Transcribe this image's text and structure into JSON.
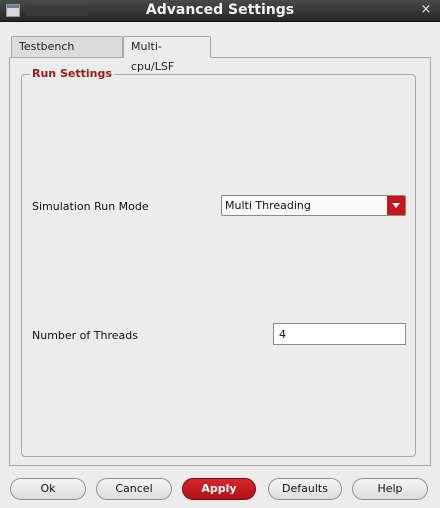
{
  "window": {
    "title": "Advanced Settings",
    "close_glyph": "×"
  },
  "tabs": [
    {
      "label": "Testbench Settings",
      "active": false
    },
    {
      "label": "Multi-cpu/LSF",
      "active": true
    }
  ],
  "run_settings": {
    "group_title": "Run Settings",
    "run_mode": {
      "label": "Simulation Run Mode",
      "value": "Multi Threading"
    },
    "threads": {
      "label": "Number of Threads",
      "value": "4"
    }
  },
  "buttons": {
    "ok": "Ok",
    "cancel": "Cancel",
    "apply": "Apply",
    "defaults": "Defaults",
    "help": "Help"
  },
  "colors": {
    "accent": "#c4161c",
    "group_title": "#9b1c1c"
  },
  "icons": [
    "window-icon",
    "close-icon",
    "dropdown-arrow-icon"
  ]
}
